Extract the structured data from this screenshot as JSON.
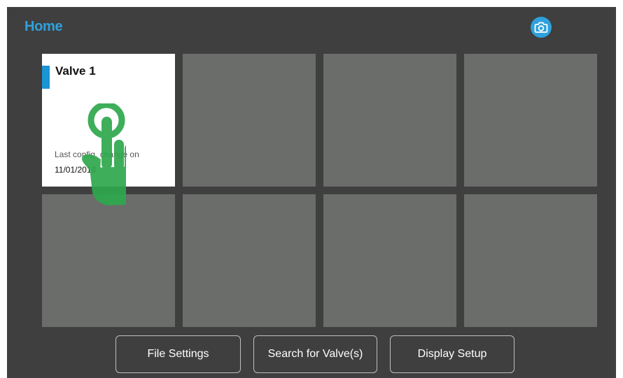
{
  "header": {
    "title": "Home",
    "camera_icon": "camera-icon"
  },
  "tiles": [
    {
      "name": "Valve 1",
      "last_config_label": "Last config. change on",
      "last_config_date": "11/01/2018",
      "selected": true
    },
    {
      "name": ""
    },
    {
      "name": ""
    },
    {
      "name": ""
    },
    {
      "name": ""
    },
    {
      "name": ""
    },
    {
      "name": ""
    },
    {
      "name": ""
    }
  ],
  "overlay": {
    "icon": "tap-hand-icon",
    "color": "#2ea84d"
  },
  "buttons": {
    "file_settings": "File Settings",
    "search_valves": "Search for Valve(s)",
    "display_setup": "Display Setup"
  },
  "colors": {
    "accent": "#2ea1dc",
    "background": "#3f3f3f",
    "tile_empty": "#6b6d6a",
    "tile_active": "#ffffff",
    "tile_marker": "#1a95d5"
  }
}
